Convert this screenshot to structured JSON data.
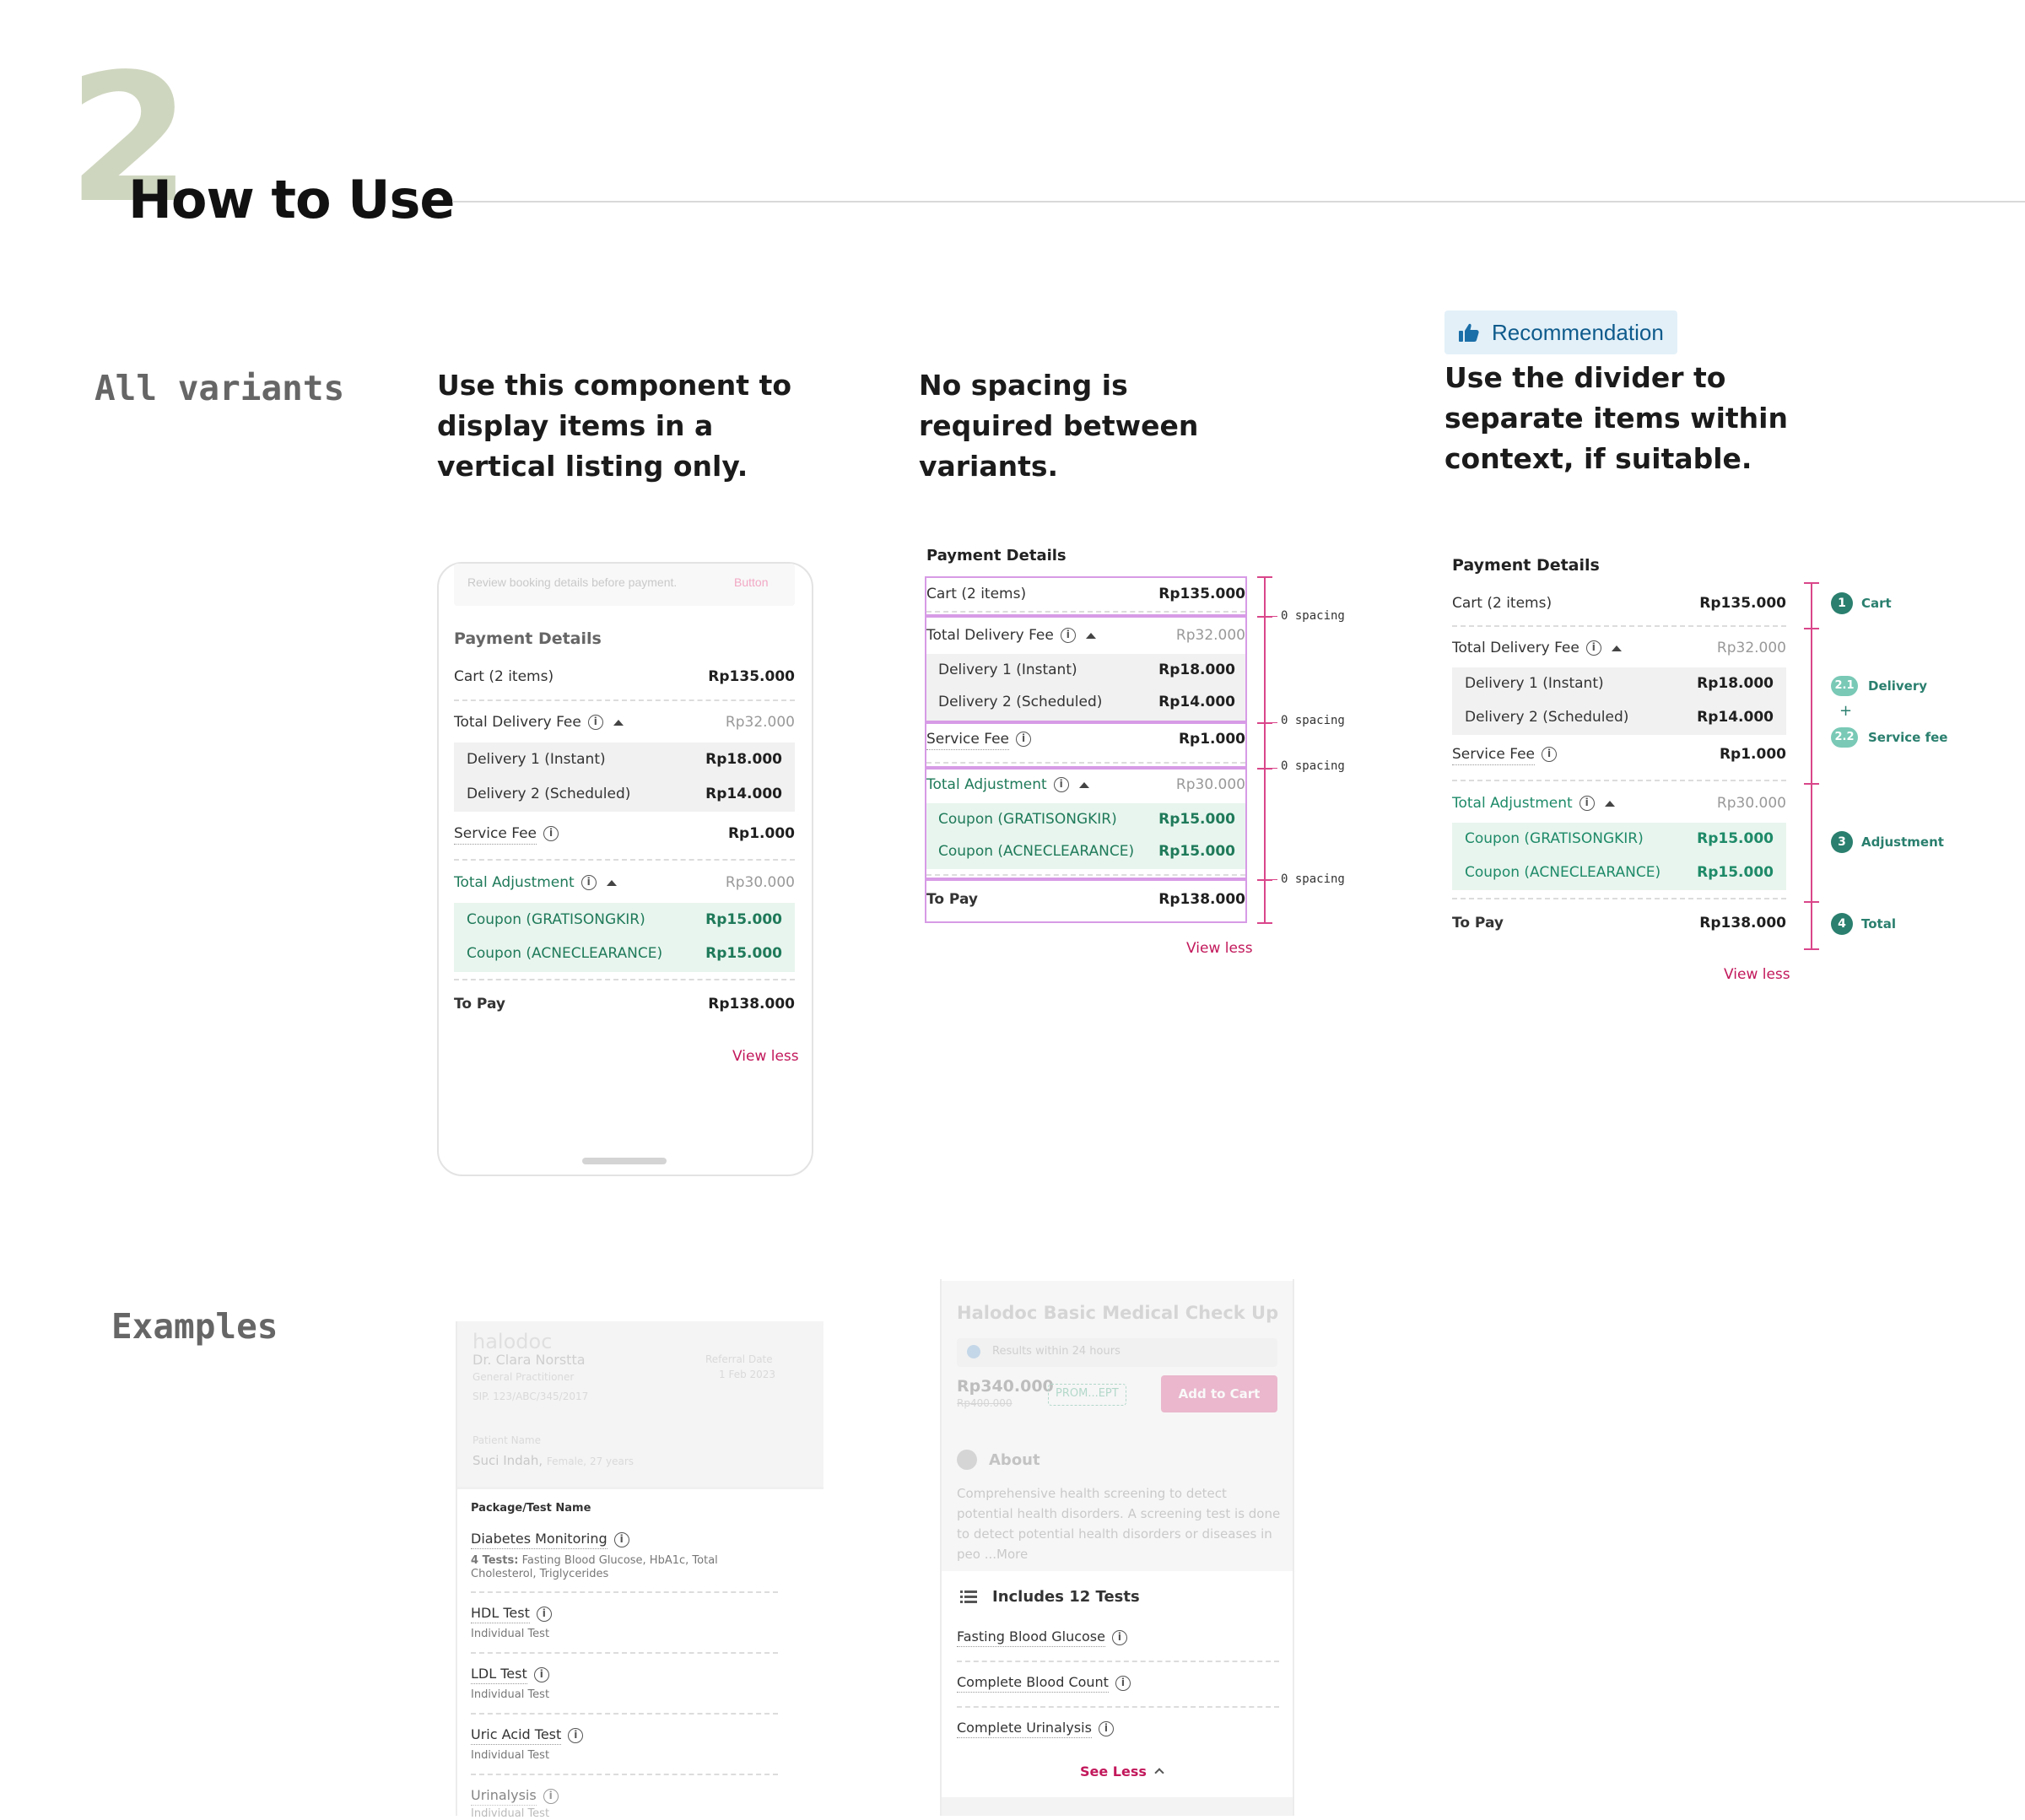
{
  "header": {
    "number": "2",
    "title": "How to Use"
  },
  "sections": {
    "all_variants": "All variants",
    "examples": "Examples"
  },
  "columns": {
    "col1": "Use this component to display items in a vertical listing only.",
    "col2": "No spacing is required between variants.",
    "badge": "Recommendation",
    "col3": "Use the divider to separate items within context, if suitable."
  },
  "phone": {
    "banner": "Review booking details before payment.",
    "banner_button": "Button"
  },
  "payment": {
    "title": "Payment Details",
    "cart_label": "Cart (2 items)",
    "cart_value": "Rp135.000",
    "delivery_label": "Total Delivery Fee",
    "delivery_value": "Rp32.000",
    "delivery1_label": "Delivery 1 (Instant)",
    "delivery1_value": "Rp18.000",
    "delivery2_label": "Delivery 2 (Scheduled)",
    "delivery2_value": "Rp14.000",
    "service_label": "Service Fee",
    "service_value": "Rp1.000",
    "adjust_label": "Total Adjustment",
    "adjust_value": "Rp30.000",
    "coupon1_label": "Coupon (GRATISONGKIR)",
    "coupon1_value": "Rp15.000",
    "coupon2_label": "Coupon (ACNECLEARANCE)",
    "coupon2_value": "Rp15.000",
    "topay_label": "To Pay",
    "topay_value": "Rp138.000",
    "view_less": "View less"
  },
  "spacing_note": "0 spacing",
  "markers": {
    "m1": "1",
    "m1_label": "Cart",
    "m21": "2.1",
    "m21_label": "Delivery",
    "plus": "+",
    "m22": "2.2",
    "m22_label": "Service fee",
    "m3": "3",
    "m3_label": "Adjustment",
    "m4": "4",
    "m4_label": "Total"
  },
  "example1": {
    "brand": "halodoc",
    "doctor": "Dr. Clara Norstta",
    "role": "General Practitioner",
    "sip": "SIP. 123/ABC/345/2017",
    "ref_label": "Referral Date",
    "ref_date": "1 Feb 2023",
    "patient_label": "Patient Name",
    "patient": "Suci Indah,",
    "patient_meta": "Female, 27 years",
    "package_header": "Package/Test Name",
    "item1": "Diabetes Monitoring",
    "item1_tests_count": "4 Tests:",
    "item1_tests": "Fasting Blood Glucose, HbA1c, Total Cholesterol, Triglycerides",
    "item2": "HDL Test",
    "item2_sub": "Individual Test",
    "item3": "LDL Test",
    "item3_sub": "Individual Test",
    "item4": "Uric Acid Test",
    "item4_sub": "Individual Test",
    "item5": "Urinalysis",
    "item5_sub": "Individual Test"
  },
  "example2": {
    "title": "Halodoc Basic Medical Check Up",
    "results": "Results within 24 hours",
    "price": "Rp340.000",
    "old_price": "Rp400.000",
    "promo": "PROM...EPT",
    "add_to_cart": "Add to Cart",
    "about": "About",
    "about_text": "Comprehensive health screening to detect potential health disorders. A screening test is done to detect potential health disorders or diseases in peo",
    "more": "...More",
    "includes": "Includes 12 Tests",
    "test1": "Fasting Blood Glucose",
    "test2": "Complete Blood Count",
    "test3": "Complete Urinalysis",
    "see_less": "See Less"
  }
}
